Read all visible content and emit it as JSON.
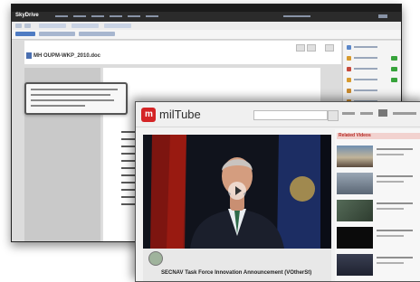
{
  "back_window": {
    "app_logo": "SkyDrive",
    "document_title": "MH OUPM-WKP_2010.doc",
    "sidebar_rows": [
      {
        "icon_color": "#5b87c9",
        "has_check": false
      },
      {
        "icon_color": "#d79a2e",
        "has_check": true
      },
      {
        "icon_color": "#c74a3b",
        "has_check": true
      },
      {
        "icon_color": "#d79a2e",
        "has_check": true
      },
      {
        "icon_color": "#c98a2e",
        "has_check": false
      },
      {
        "icon_color": "#c98a2e",
        "has_check": false
      }
    ]
  },
  "front_window": {
    "brand_letter": "m",
    "brand_name": "milTube",
    "video_title": "SECNAV Task Force Innovation Announcement (VOtherSt)",
    "related_header": "Related Videos"
  },
  "colors": {
    "brand_red": "#d42426",
    "check_green": "#37a33b",
    "related_header_text": "#b52a24"
  }
}
